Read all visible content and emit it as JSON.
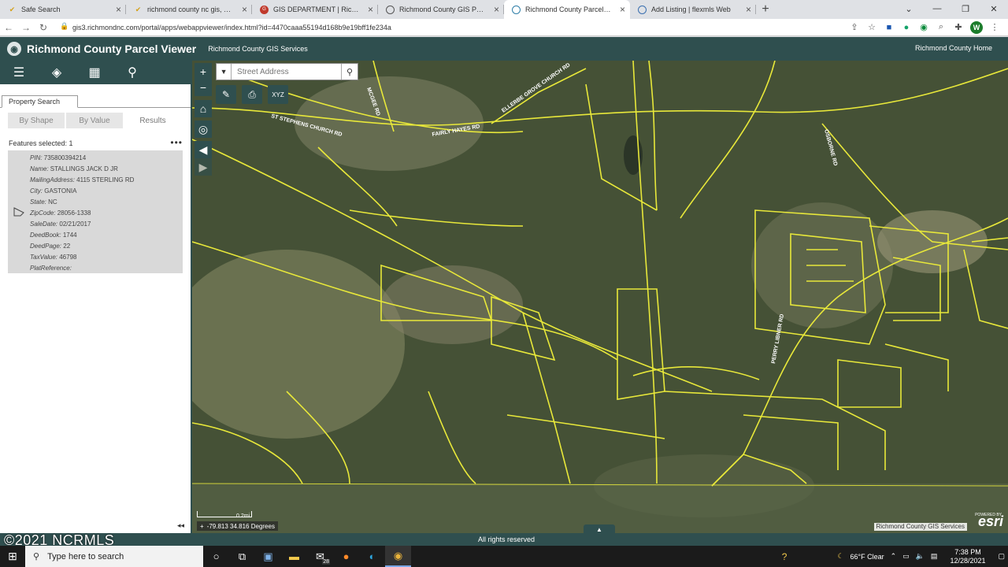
{
  "browser": {
    "tabs": [
      {
        "title": "Safe Search",
        "icon": "check-icon",
        "active": false
      },
      {
        "title": "richmond county nc gis, Norton S...",
        "icon": "check-icon",
        "active": false
      },
      {
        "title": "GIS DEPARTMENT | Richmond Cou...",
        "icon": "gis-icon",
        "active": false
      },
      {
        "title": "Richmond County GIS Portal",
        "icon": "globe-icon",
        "active": false
      },
      {
        "title": "Richmond County Parcel Viewer",
        "icon": "globe-icon",
        "active": true
      },
      {
        "title": "Add Listing | flexmls Web",
        "icon": "flexmls-icon",
        "active": false
      }
    ],
    "url": "gis3.richmondnc.com/portal/apps/webappviewer/index.html?id=4470caaa55194d168b9e19bff1fe234a",
    "profile_initial": "W"
  },
  "app": {
    "title": "Richmond County Parcel Viewer",
    "subtitle": "Richmond County GIS Services",
    "home_link": "Richmond County Home"
  },
  "panel": {
    "tab_label": "Property Search",
    "subtabs": [
      "By Shape",
      "By Value",
      "Results"
    ],
    "features_selected": "Features selected: 1",
    "result_fields": [
      {
        "label": "PIN:",
        "value": "735800394214"
      },
      {
        "label": "Name:",
        "value": "STALLINGS JACK D JR"
      },
      {
        "label": "MailingAddress:",
        "value": "4115 STERLING RD"
      },
      {
        "label": "City:",
        "value": "GASTONIA"
      },
      {
        "label": "State:",
        "value": "NC"
      },
      {
        "label": "ZipCode:",
        "value": "28056-1338"
      },
      {
        "label": "SaleDate:",
        "value": "02/21/2017"
      },
      {
        "label": "DeedBook:",
        "value": "1744"
      },
      {
        "label": "DeedPage:",
        "value": "22"
      },
      {
        "label": "TaxValue:",
        "value": "46798"
      },
      {
        "label": "PlatReference:",
        "value": ""
      }
    ]
  },
  "map": {
    "search_placeholder": "Street Address",
    "coordinates": "-79.813 34.816 Degrees",
    "scale_label": "0.2mi",
    "attribution": "Richmond County GIS Services",
    "esri_logo": "esri",
    "esri_powered": "POWERED BY",
    "road_labels": [
      "ST STEPHENS CHURCH RD",
      "FAIRLY HAYES RD",
      "ELLERBE GROVE CHURCH RD",
      "MCGEE RD",
      "OSBORNE RD",
      "PERRY LIBNER RD"
    ],
    "parcel_color": "#e8e83a"
  },
  "footer": {
    "rights": "All rights reserved",
    "watermark": "©2021 NCRMLS"
  },
  "taskbar": {
    "search_placeholder": "Type here to search",
    "weather": "66°F  Clear",
    "time": "7:38 PM",
    "date": "12/28/2021",
    "badge": "28"
  },
  "colors": {
    "header": "#2f4f4f",
    "tab_bar": "#dfe1e5"
  }
}
